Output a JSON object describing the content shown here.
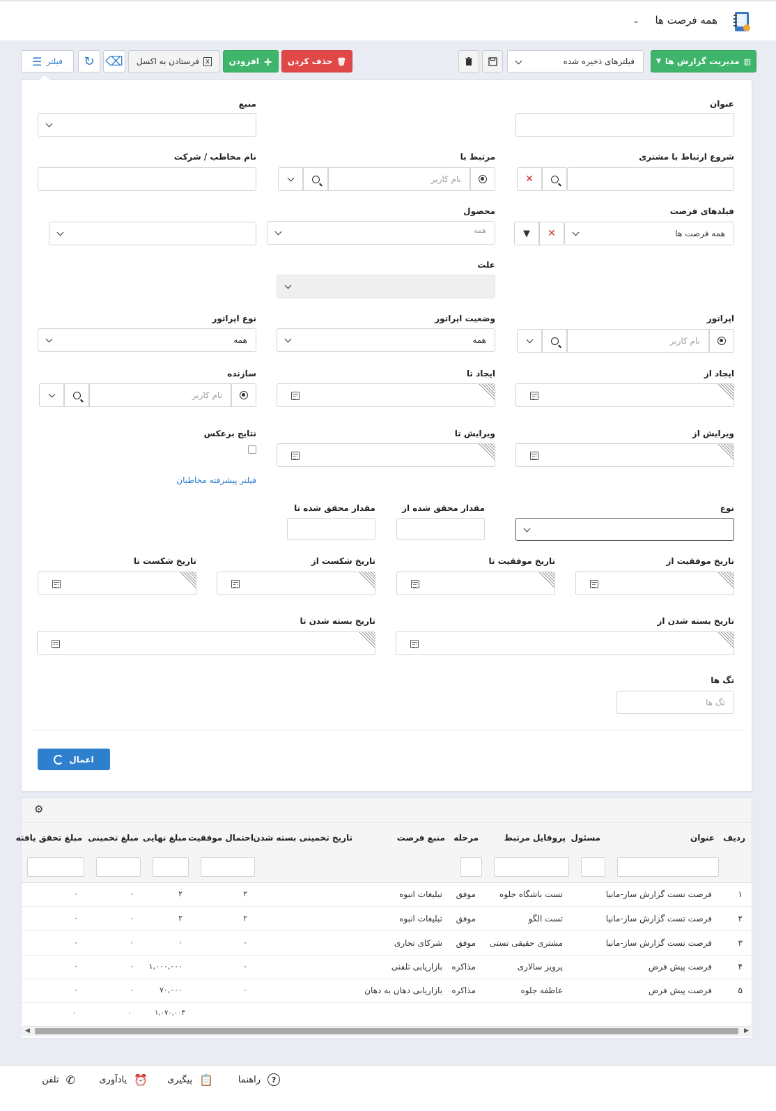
{
  "header": {
    "title": "همه فرصت ها"
  },
  "toolbar": {
    "report_manage": "مدیریت گزارش ها",
    "saved_filters": "فیلترهای ذخیره شده",
    "delete": "حذف کردن",
    "add": "افزودن",
    "send_excel": "فرستادن به اکسل",
    "filter": "فیلتر"
  },
  "filters": {
    "title_label": "عنوان",
    "source_label": "منبع",
    "customer_start_label": "شروع ارتباط با مشتری",
    "related_label": "مرتبط با",
    "related_placeholder": "نام کاربر",
    "contact_company_label": "نام مخاطب / شرکت",
    "opp_fields_label": "فیلدهای فرصت",
    "opp_fields_value": "همه فرصت ها",
    "product_label": "محصول",
    "product_value": "همه",
    "reason_label": "علت",
    "operator_label": "اپراتور",
    "operator_placeholder": "نام کاربر",
    "operator_status_label": "وضعیت اپراتور",
    "operator_status_value": "همه",
    "operator_type_label": "نوع اپراتور",
    "operator_type_value": "همه",
    "created_from_label": "ایجاد از",
    "created_to_label": "ایجاد تا",
    "creator_label": "سازنده",
    "creator_placeholder": "نام کاربر",
    "edited_from_label": "ویرایش از",
    "edited_to_label": "ویرایش تا",
    "reverse_label": "نتایج برعکس",
    "advanced_contacts": "فیلتر پیشرفته مخاطبان",
    "type_label": "نوع",
    "achieved_from_label": "مقدار محقق شده از",
    "achieved_to_label": "مقدار محقق شده تا",
    "win_from_label": "تاریخ موفقیت از",
    "win_to_label": "تاریخ موفقیت تا",
    "loss_from_label": "تاریخ شکست از",
    "loss_to_label": "تاریخ شکست تا",
    "closed_from_label": "تاریخ بسته شدن از",
    "closed_to_label": "تاریخ بسته شدن تا",
    "tags_label": "تگ ها",
    "tags_placeholder": "تگ ها",
    "apply": "اعمال"
  },
  "table": {
    "columns": [
      "ردیف",
      "عنوان",
      "مسئول",
      "پروفایل مرتبط",
      "مرحله",
      "منبع فرصت",
      "تاریخ تخمینی بسته شدن",
      "احتمال موفقیت",
      "مبلغ نهایی",
      "مبلغ تخمینی",
      "مبلغ تحقق یافته"
    ],
    "rows": [
      {
        "idx": "۱",
        "title": "فرصت تست گزارش ساز-مانیا",
        "owner": "",
        "profile": "تست باشگاه جلوه",
        "stage": "موفق",
        "source": "تبلیغات انبوه",
        "est_close": "",
        "prob": "۲",
        "final": "۲",
        "estimate": "۰",
        "achieved": "۰"
      },
      {
        "idx": "۲",
        "title": "فرصت تست گزارش ساز-مانیا",
        "owner": "",
        "profile": "تست الگو",
        "stage": "موفق",
        "source": "تبلیغات انبوه",
        "est_close": "",
        "prob": "۲",
        "final": "۲",
        "estimate": "۰",
        "achieved": "۰"
      },
      {
        "idx": "۳",
        "title": "فرصت تست گزارش ساز-مانیا",
        "owner": "",
        "profile": "مشتری حقیقی تستی",
        "stage": "موفق",
        "source": "شرکای تجاری",
        "est_close": "",
        "prob": "۰",
        "final": "۰",
        "estimate": "۰",
        "achieved": "۰"
      },
      {
        "idx": "۴",
        "title": "فرصت پیش فرض",
        "owner": "",
        "profile": "پرویز سالاری",
        "stage": "مذاکره",
        "source": "بازاریابی تلفنی",
        "est_close": "",
        "prob": "۰",
        "final": "۱,۰۰۰,۰۰۰",
        "estimate": "۰",
        "achieved": "۰"
      },
      {
        "idx": "۵",
        "title": "فرصت پیش فرض",
        "owner": "",
        "profile": "عاطفه جلوه",
        "stage": "مذاکره",
        "source": "بازاریابی دهان به دهان",
        "est_close": "",
        "prob": "۰",
        "final": "۷۰,۰۰۰",
        "estimate": "۰",
        "achieved": "۰"
      }
    ],
    "totals": {
      "final": "۱,۰۷۰,۰۰۴",
      "estimate": "۰",
      "achieved": "۰"
    }
  },
  "footer": {
    "help": "راهنما",
    "followup": "پیگیری",
    "reminder": "یادآوری",
    "phone": "تلفن"
  }
}
